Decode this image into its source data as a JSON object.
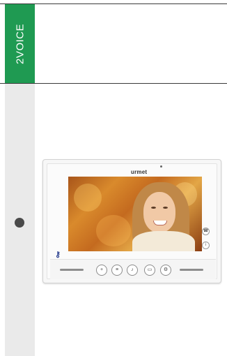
{
  "brand_tab": {
    "label": "2VOICE",
    "color": "#1f9a52"
  },
  "device": {
    "brand": "urmet",
    "screen_subject": "woman-portrait",
    "left_icon": "key-icon",
    "side_buttons": [
      {
        "name": "intercom-icon",
        "glyph": "☎"
      },
      {
        "name": "info-icon",
        "glyph": "i"
      }
    ],
    "controls": [
      {
        "name": "plus-icon",
        "glyph": "+"
      },
      {
        "name": "menu-icon",
        "glyph": "≡"
      },
      {
        "name": "mute-icon",
        "glyph": "♪"
      },
      {
        "name": "camera-icon",
        "glyph": "▭"
      },
      {
        "name": "settings-icon",
        "glyph": "⚙"
      }
    ]
  }
}
